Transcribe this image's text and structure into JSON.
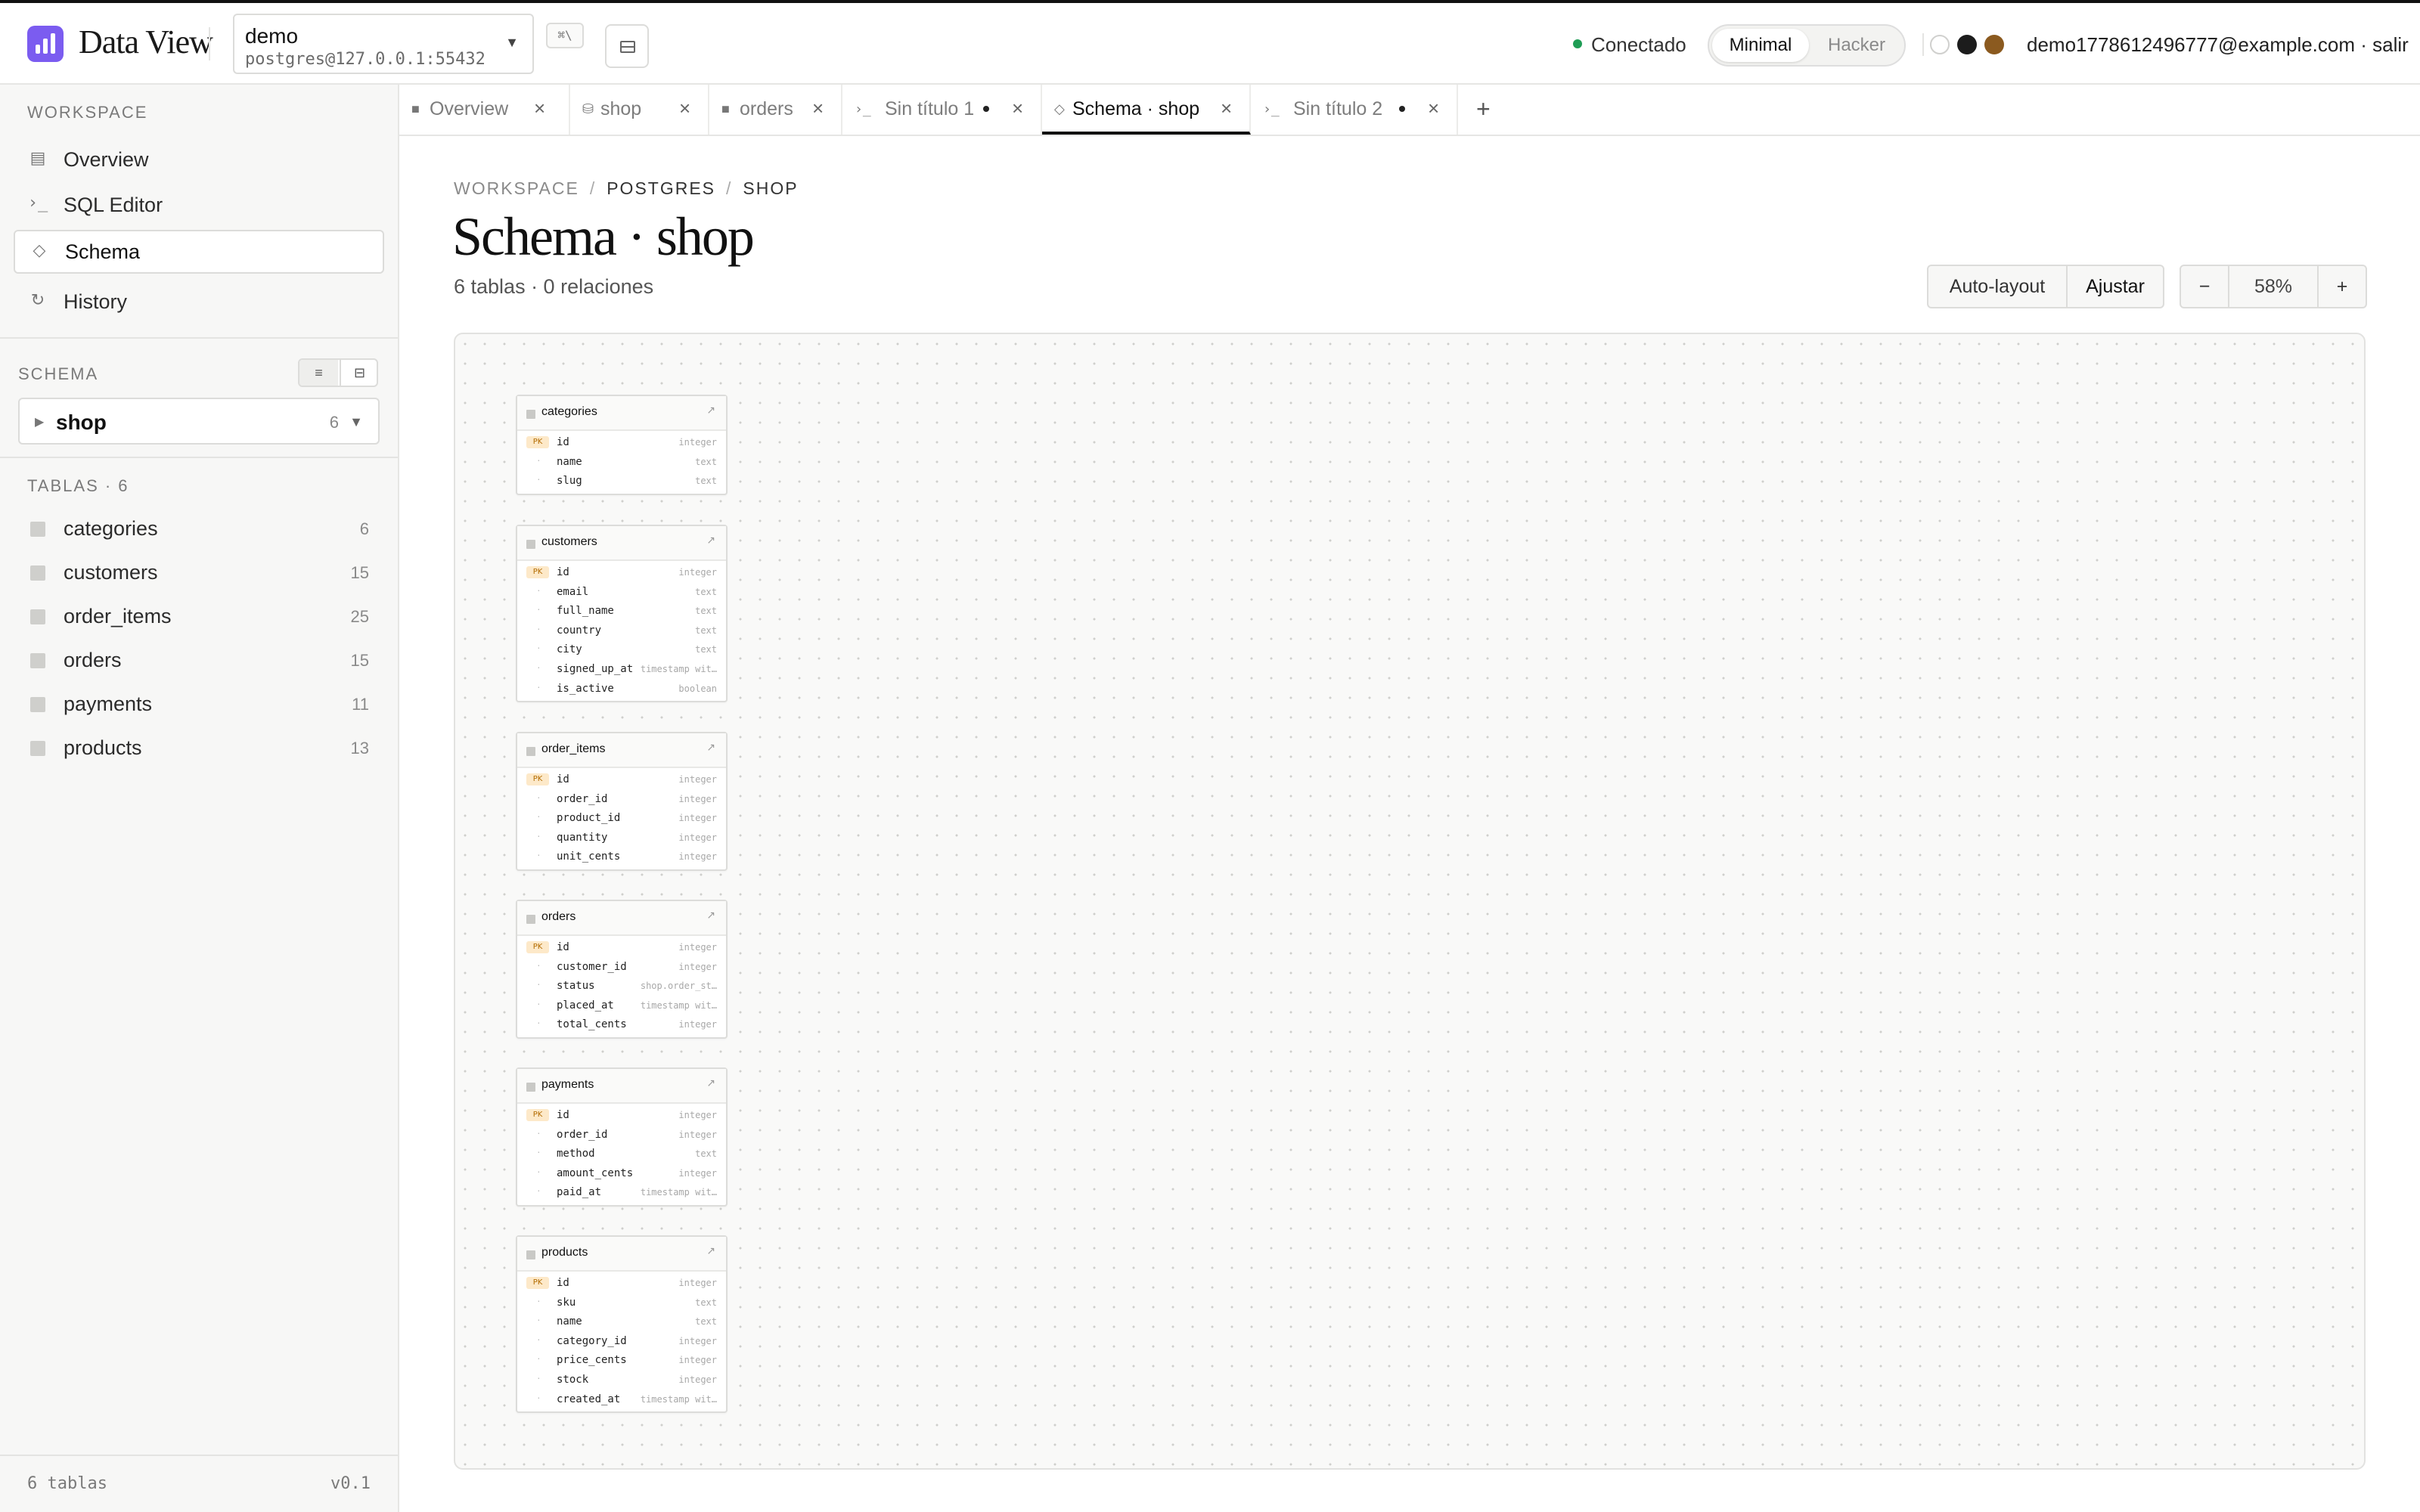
{
  "app": {
    "title": "Data View",
    "accent": "#7b5cf0"
  },
  "connection": {
    "name": "demo",
    "dsn": "postgres@127.0.0.1:55432",
    "shortcut": "⌘\\"
  },
  "status": {
    "label": "Conectado",
    "color": "#1f9d55"
  },
  "modes": {
    "minimal": "Minimal",
    "hacker": "Hacker",
    "selected": "Minimal"
  },
  "swatches": [
    "#ffffff",
    "#1c1c1c",
    "#8b5a1f"
  ],
  "user": {
    "email": "demo1778612496777@example.com",
    "separator": "·",
    "logout": "salir"
  },
  "sidebar": {
    "workspace_label": "WORKSPACE",
    "nav": [
      {
        "icon": "overview-icon",
        "label": "Overview"
      },
      {
        "icon": "terminal-icon",
        "label": "SQL Editor"
      },
      {
        "icon": "diamond-icon",
        "label": "Schema",
        "active": true
      },
      {
        "icon": "history-icon",
        "label": "History"
      }
    ],
    "schema_label": "SCHEMA",
    "schema_select": {
      "name": "shop",
      "count": "6"
    },
    "tables_label": "TABLAS · 6",
    "tables": [
      {
        "name": "categories",
        "count": "6"
      },
      {
        "name": "customers",
        "count": "15"
      },
      {
        "name": "order_items",
        "count": "25"
      },
      {
        "name": "orders",
        "count": "15"
      },
      {
        "name": "payments",
        "count": "11"
      },
      {
        "name": "products",
        "count": "13"
      }
    ],
    "footer_left": "6 tablas",
    "footer_right": "v0.1"
  },
  "tabs": [
    {
      "icon": "table-icon",
      "label": "Overview"
    },
    {
      "icon": "database-icon",
      "label": "shop"
    },
    {
      "icon": "table-icon",
      "label": "orders"
    },
    {
      "icon": "terminal-icon",
      "label": "Sin título 1",
      "dirty": true
    },
    {
      "icon": "diamond-icon",
      "label": "Schema · shop",
      "active": true
    },
    {
      "icon": "terminal-icon",
      "label": "Sin título 2",
      "dirty": true
    }
  ],
  "breadcrumb": [
    "WORKSPACE",
    "POSTGRES",
    "SHOP"
  ],
  "page": {
    "title": "Schema · shop",
    "subtitle": "6 tablas · 0 relaciones"
  },
  "toolbar": {
    "auto_layout": "Auto-layout",
    "fit": "Ajustar",
    "zoom_out": "−",
    "zoom": "58%",
    "zoom_in": "+"
  },
  "tables": [
    {
      "name": "categories",
      "columns": [
        {
          "name": "id",
          "type": "integer",
          "pk": true
        },
        {
          "name": "name",
          "type": "text"
        },
        {
          "name": "slug",
          "type": "text"
        }
      ]
    },
    {
      "name": "customers",
      "columns": [
        {
          "name": "id",
          "type": "integer",
          "pk": true
        },
        {
          "name": "email",
          "type": "text"
        },
        {
          "name": "full_name",
          "type": "text"
        },
        {
          "name": "country",
          "type": "text"
        },
        {
          "name": "city",
          "type": "text"
        },
        {
          "name": "signed_up_at",
          "type": "timestamp wit…"
        },
        {
          "name": "is_active",
          "type": "boolean"
        }
      ]
    },
    {
      "name": "order_items",
      "columns": [
        {
          "name": "id",
          "type": "integer",
          "pk": true
        },
        {
          "name": "order_id",
          "type": "integer"
        },
        {
          "name": "product_id",
          "type": "integer"
        },
        {
          "name": "quantity",
          "type": "integer"
        },
        {
          "name": "unit_cents",
          "type": "integer"
        }
      ]
    },
    {
      "name": "orders",
      "columns": [
        {
          "name": "id",
          "type": "integer",
          "pk": true
        },
        {
          "name": "customer_id",
          "type": "integer"
        },
        {
          "name": "status",
          "type": "shop.order_st…"
        },
        {
          "name": "placed_at",
          "type": "timestamp wit…"
        },
        {
          "name": "total_cents",
          "type": "integer"
        }
      ]
    },
    {
      "name": "payments",
      "columns": [
        {
          "name": "id",
          "type": "integer",
          "pk": true
        },
        {
          "name": "order_id",
          "type": "integer"
        },
        {
          "name": "method",
          "type": "text"
        },
        {
          "name": "amount_cents",
          "type": "integer"
        },
        {
          "name": "paid_at",
          "type": "timestamp wit…"
        }
      ]
    },
    {
      "name": "products",
      "columns": [
        {
          "name": "id",
          "type": "integer",
          "pk": true
        },
        {
          "name": "sku",
          "type": "text"
        },
        {
          "name": "name",
          "type": "text"
        },
        {
          "name": "category_id",
          "type": "integer"
        },
        {
          "name": "price_cents",
          "type": "integer"
        },
        {
          "name": "stock",
          "type": "integer"
        },
        {
          "name": "created_at",
          "type": "timestamp wit…"
        }
      ]
    }
  ]
}
